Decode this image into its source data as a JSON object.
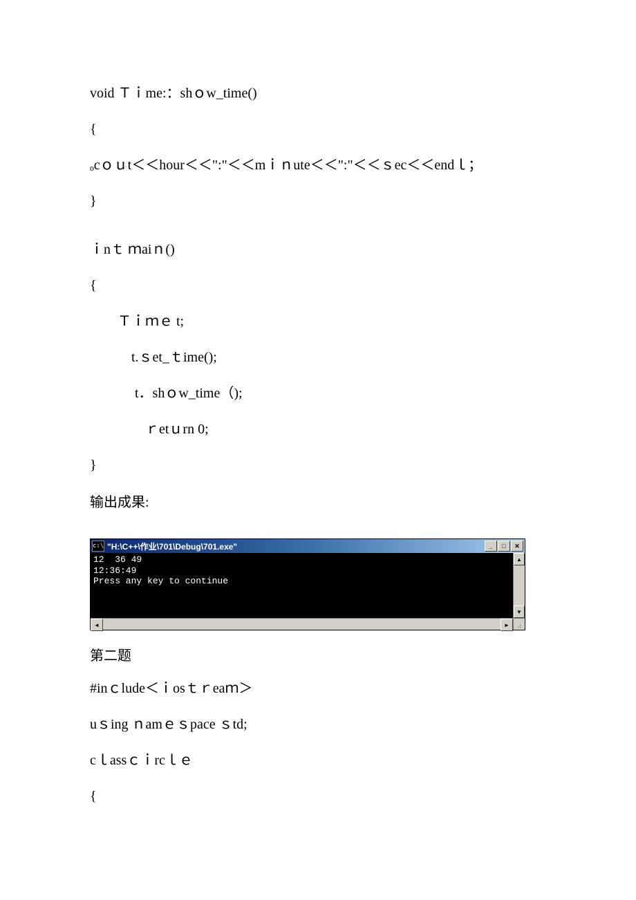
{
  "code_block1": {
    "l1": "void Ｔｉme:：shｏw_time()",
    "l2": "{",
    "l3": "ₒcｏｕt＜＜hour＜＜\":\"＜＜mｉｎute＜＜\":\"＜＜ｓec＜＜endｌ；",
    "l4": "}",
    "l5": "ｉnｔ ｍaiｎ()",
    "l6": "{",
    "l7": "Ｔｉｍｅ  t;",
    "l8": "t.ｓet_ｔime();",
    "l9": "t．shｏw_time（);",
    "l10": "ｒetｕrn 0;",
    "l11": "}"
  },
  "output_label": "输出成果:",
  "console": {
    "icon": "c:\\",
    "title": "\"H:\\C++\\作业\\701\\Debug\\701.exe\"",
    "line1": "12  36 49",
    "line2": "12:36:49",
    "line3": "Press any key to continue"
  },
  "section2_title": "第二题",
  "code_block2": {
    "l1": "#inｃlude＜ｉosｔｒeaｍ＞",
    "l2": "uｓing  ｎamｅｓpace ｓtd;",
    "l3": "cｌassｃｉrcｌｅ",
    "l4": "{"
  }
}
